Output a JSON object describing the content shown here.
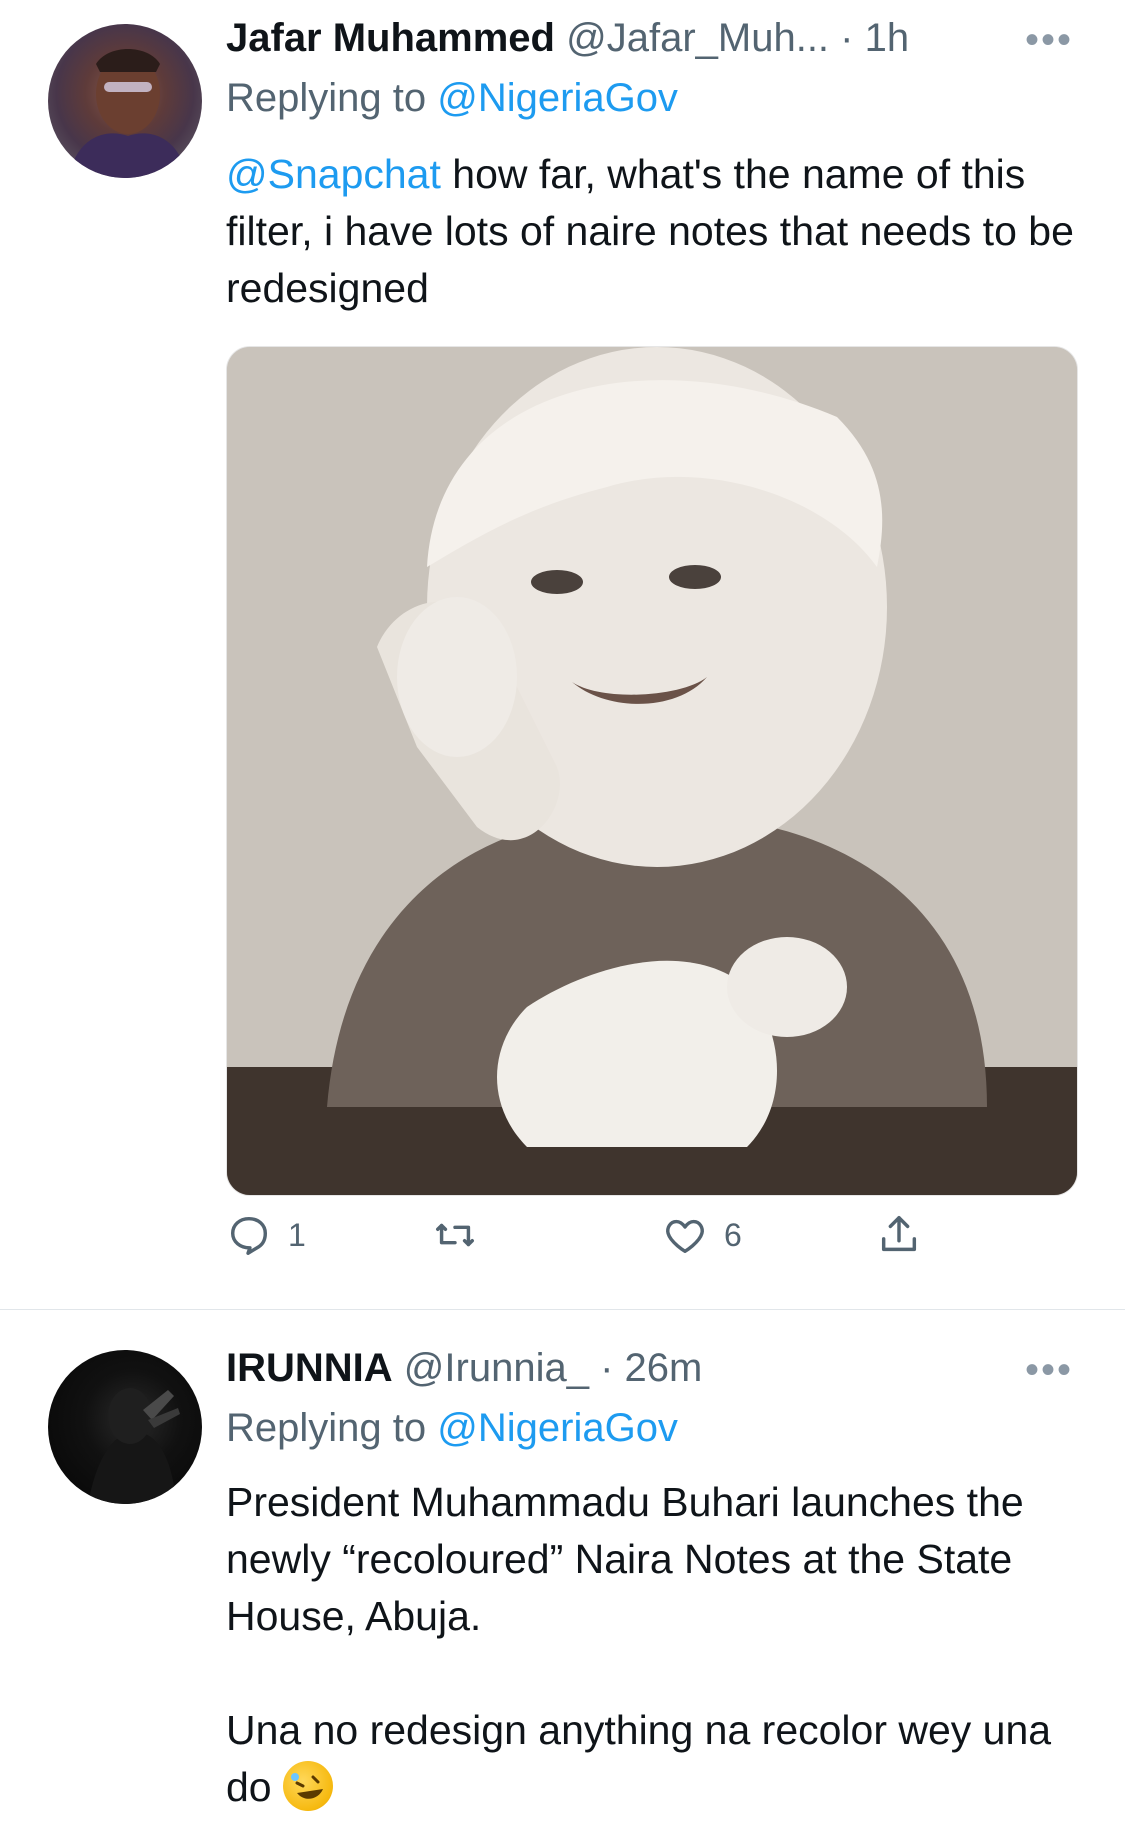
{
  "tweets": [
    {
      "name": "Jafar Muhammed",
      "handle": "@Jafar_Muh...",
      "time": "· 1h",
      "replying_prefix": "Replying to",
      "replying_to": "@NigeriaGov",
      "mention": "@Snapchat",
      "text": " how far, what's the name of this filter, i have lots of naire notes that needs to be redesigned",
      "reply_count": "1",
      "like_count": "6"
    },
    {
      "name": "IRUNNIA",
      "handle": "@Irunnia_",
      "time": "· 26m",
      "replying_prefix": "Replying to",
      "replying_to": "@NigeriaGov",
      "text_p1": "President Muhammadu Buhari launches the newly “recoloured” Naira Notes at the State House, Abuja.",
      "text_p2": "Una no redesign anything na recolor wey una do"
    }
  ],
  "icons": {
    "more": "more-icon",
    "reply": "reply-icon",
    "retweet": "retweet-icon",
    "like": "heart-icon",
    "share": "share-icon"
  },
  "colors": {
    "link": "#1d9bf0",
    "muted": "#536471",
    "text": "#0f1419"
  }
}
